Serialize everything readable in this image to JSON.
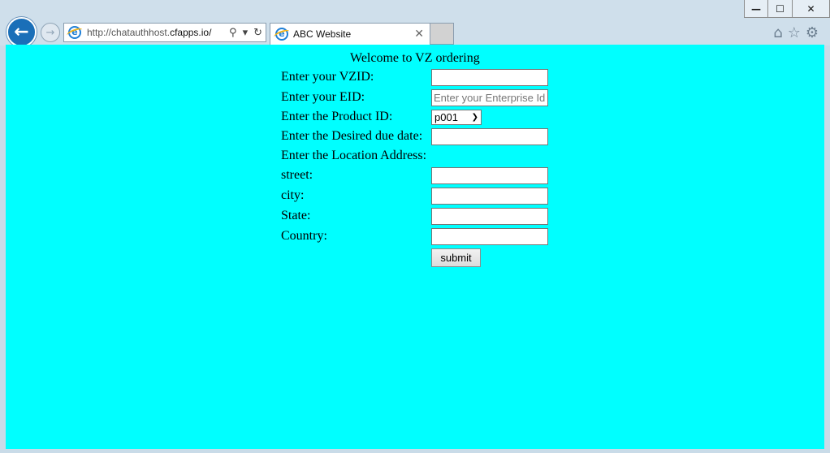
{
  "window": {
    "minimize_glyph": "—",
    "maximize_glyph": "☐",
    "close_glyph": "✕"
  },
  "nav": {
    "back_glyph": "←",
    "forward_glyph": "→"
  },
  "address_bar": {
    "url_prefix": "http://chatauthhost.",
    "url_domain": "cfapps.io/",
    "search_glyph": "⚲",
    "dropdown_glyph": "▾",
    "refresh_glyph": "↻"
  },
  "tab": {
    "title": "ABC Website",
    "close_glyph": "✕"
  },
  "toolbar": {
    "home_glyph": "⌂",
    "favorites_glyph": "☆",
    "settings_glyph": "⚙"
  },
  "page": {
    "background": "#00ffff",
    "welcome": "Welcome to VZ ordering",
    "form": {
      "vzid_label": "Enter your VZID:",
      "vzid_value": "",
      "eid_label": "Enter your EID:",
      "eid_placeholder": "Enter your Enterprise Id",
      "product_label": "Enter the Product ID:",
      "product_selected": "p001",
      "due_date_label": "Enter the Desired due date:",
      "due_date_value": "",
      "location_label": "Enter the Location Address:",
      "street_label": "street:",
      "city_label": "city:",
      "state_label": "State:",
      "country_label": "Country:",
      "submit_label": "submit"
    }
  }
}
